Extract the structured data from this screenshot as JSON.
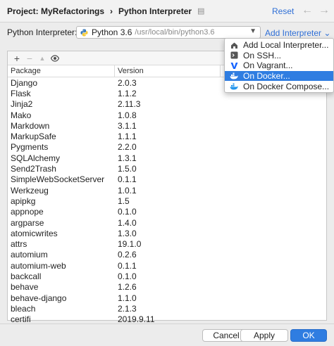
{
  "header": {
    "project": "Project: MyRefactorings",
    "separator": "›",
    "title": "Python Interpreter",
    "page_icon": "▤",
    "reset": "Reset",
    "back_arrow": "←",
    "forward_arrow": "→"
  },
  "interpreter": {
    "label": "Python Interpreter:",
    "selected": "Python 3.6",
    "path": "/usr/local/bin/python3.6",
    "add_link": "Add Interpreter ⌄"
  },
  "toolbar": {
    "add": "+",
    "remove": "−",
    "upgrade": "▲",
    "show_early": "👁"
  },
  "table": {
    "headers": [
      "Package",
      "Version",
      ""
    ],
    "rows": [
      [
        "Django",
        "2.0.3"
      ],
      [
        "Flask",
        "1.1.2"
      ],
      [
        "Jinja2",
        "2.11.3"
      ],
      [
        "Mako",
        "1.0.8"
      ],
      [
        "Markdown",
        "3.1.1"
      ],
      [
        "MarkupSafe",
        "1.1.1"
      ],
      [
        "Pygments",
        "2.2.0"
      ],
      [
        "SQLAlchemy",
        "1.3.1"
      ],
      [
        "Send2Trash",
        "1.5.0"
      ],
      [
        "SimpleWebSocketServer",
        "0.1.1"
      ],
      [
        "Werkzeug",
        "1.0.1"
      ],
      [
        "apipkg",
        "1.5"
      ],
      [
        "appnope",
        "0.1.0"
      ],
      [
        "argparse",
        "1.4.0"
      ],
      [
        "atomicwrites",
        "1.3.0"
      ],
      [
        "attrs",
        "19.1.0"
      ],
      [
        "automium",
        "0.2.6"
      ],
      [
        "automium-web",
        "0.1.1"
      ],
      [
        "backcall",
        "0.1.0"
      ],
      [
        "behave",
        "1.2.6"
      ],
      [
        "behave-django",
        "1.1.0"
      ],
      [
        "bleach",
        "2.1.3"
      ],
      [
        "certifi",
        "2019.9.11"
      ]
    ]
  },
  "menu": {
    "items": [
      {
        "label": "Add Local Interpreter...",
        "icon": "house-icon"
      },
      {
        "label": "On SSH...",
        "icon": "terminal-icon"
      },
      {
        "label": "On Vagrant...",
        "icon": "vagrant-icon"
      },
      {
        "label": "On Docker...",
        "icon": "docker-icon",
        "selected": true
      },
      {
        "label": "On Docker Compose...",
        "icon": "docker-compose-icon"
      }
    ]
  },
  "footer": {
    "cancel": "Cancel",
    "apply": "Apply",
    "ok": "OK"
  },
  "colors": {
    "accent": "#2f7de1",
    "link": "#2f6fd6"
  }
}
